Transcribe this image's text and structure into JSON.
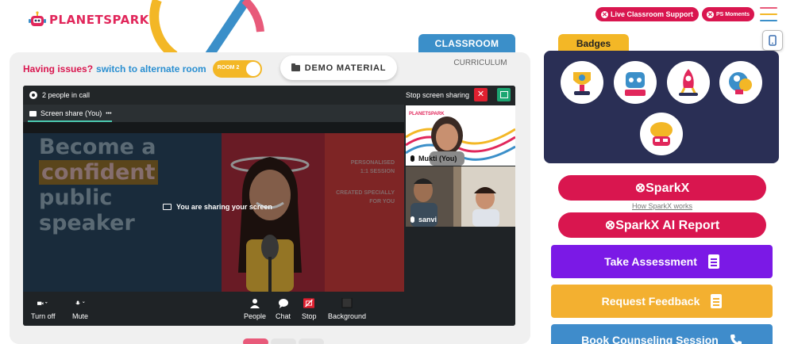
{
  "app": {
    "logo_text": "PLANETSPARK"
  },
  "top_actions": {
    "live_support": "Live Classroom Support",
    "ps_moments": "PS Moments"
  },
  "tabs": {
    "classroom": "CLASSROOM",
    "curriculum": "CURRICULUM"
  },
  "room": {
    "issues_text": "Having issues?",
    "switch_text": "switch to alternate room",
    "room_label": "ROOM 2"
  },
  "demo_material": "DEMO MATERIAL",
  "call": {
    "people_count": "2 people in call",
    "stop_sharing": "Stop screen sharing",
    "share_tab": "Screen share (You)",
    "share_tab_more": "•••",
    "sharing_message": "You are sharing your screen",
    "slide": {
      "line1": "Become a",
      "line2": "confident",
      "line3": "public",
      "line4": "speaker",
      "side1": "PERSONALISED",
      "side2": "1:1 SESSION",
      "side3": "CREATED SPECIALLY",
      "side4": "FOR YOU"
    },
    "participants": [
      {
        "name": "Mukti (You)"
      },
      {
        "name": "sanvi"
      }
    ],
    "controls": {
      "turn_off": "Turn off",
      "mute": "Mute",
      "people": "People",
      "chat": "Chat",
      "stop": "Stop",
      "background": "Background"
    }
  },
  "badges": {
    "title": "Badges",
    "items": [
      "trophy-badge",
      "robot-badge",
      "rocket-badge",
      "idea-badge",
      "brain-badge"
    ]
  },
  "sparkx": {
    "label": "⊗SparkX",
    "how_link": "How SparkX works",
    "ai_report": "⊗SparkX AI Report"
  },
  "actions": {
    "take_assessment": "Take Assessment",
    "request_feedback": "Request Feedback",
    "book_counseling": "Book Counseling Session"
  },
  "colors": {
    "brand_pink": "#d9164f",
    "classroom_blue": "#3b8fc9",
    "badges_yellow": "#f3b726",
    "badges_panel": "#2a2f55",
    "assessment_purple": "#7b19e6",
    "feedback_orange": "#f3b030",
    "counseling_blue": "#3f8ccb"
  }
}
